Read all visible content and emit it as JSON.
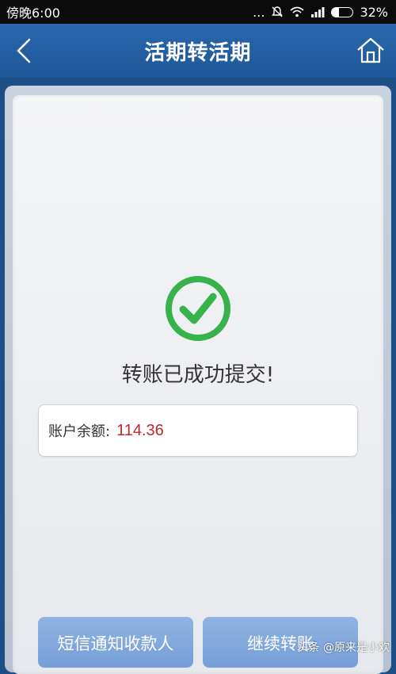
{
  "status_bar": {
    "time": "傍晚6:00",
    "signal_dots": "...",
    "battery_text": "32%",
    "battery_level": 0.32
  },
  "header": {
    "title": "活期转活期"
  },
  "result": {
    "message": "转账已成功提交!",
    "balance_label": "账户余额:",
    "balance_value": "114.36"
  },
  "buttons": {
    "sms_notify": "短信通知收款人",
    "continue_transfer": "继续转账"
  },
  "watermark": {
    "text": "头条 @原来是小欢"
  },
  "colors": {
    "header_blue": "#2a66ad",
    "success_green": "#38b24a",
    "balance_red": "#c0282d",
    "button_blue": "#8fb4e3"
  },
  "icons": {
    "back": "chevron-left-icon",
    "home": "home-icon",
    "success": "check-circle-icon",
    "mute": "bell-off-icon",
    "wifi": "wifi-icon",
    "signal": "signal-icon",
    "battery": "battery-icon"
  }
}
